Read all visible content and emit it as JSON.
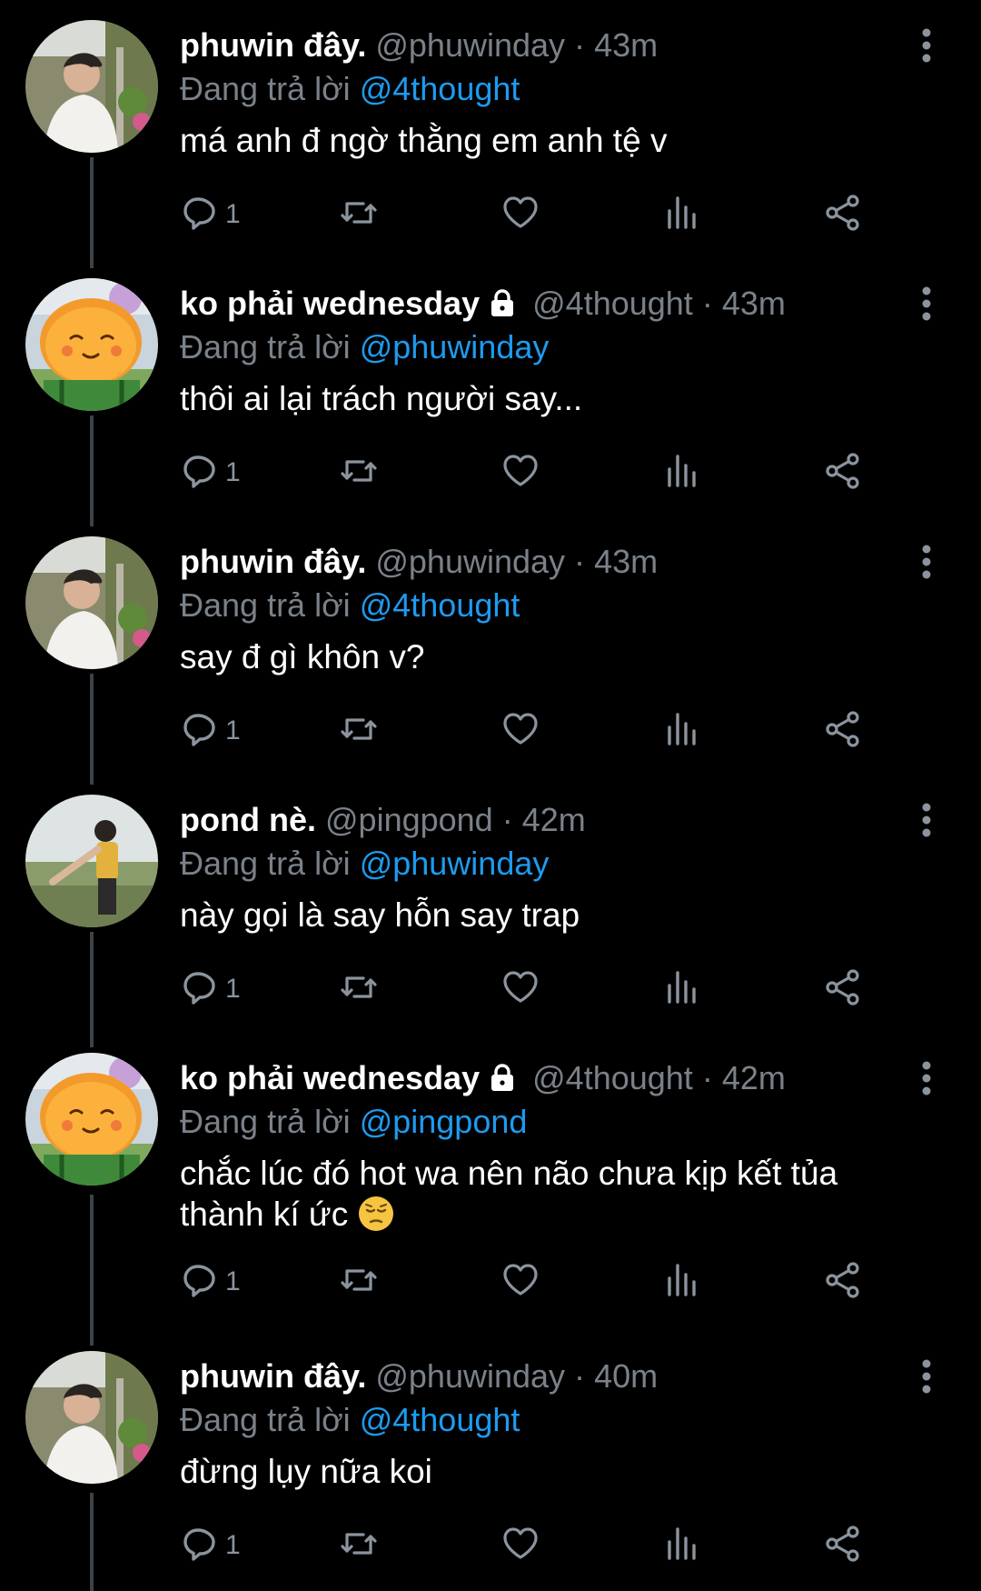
{
  "colors": {
    "background": "#000000",
    "muted": "#7a8189",
    "link": "#1d9bf0",
    "thread_line": "#3d4247"
  },
  "tweets": [
    {
      "name": "phuwin đây.",
      "locked": false,
      "handle": "@phuwinday",
      "sep": "·",
      "time": "43m",
      "reply_prefix": "Đang trả lời",
      "reply_to": "@4thought",
      "text": "má anh đ ngờ thằng em anh tệ v",
      "reply_count": "1",
      "avatar": "phuwin"
    },
    {
      "name": "ko phải wednesday",
      "locked": true,
      "handle": "@4thought",
      "sep": "·",
      "time": "43m",
      "reply_prefix": "Đang trả lời",
      "reply_to": "@phuwinday",
      "text": "thôi ai lại trách người say...",
      "reply_count": "1",
      "avatar": "cartoon"
    },
    {
      "name": "phuwin đây.",
      "locked": false,
      "handle": "@phuwinday",
      "sep": "·",
      "time": "43m",
      "reply_prefix": "Đang trả lời",
      "reply_to": "@4thought",
      "text": "say đ gì khôn v?",
      "reply_count": "1",
      "avatar": "phuwin"
    },
    {
      "name": "pond nè.",
      "locked": false,
      "handle": "@pingpond",
      "sep": "·",
      "time": "42m",
      "reply_prefix": "Đang trả lời",
      "reply_to": "@phuwinday",
      "text": "này gọi là say hỗn say trap",
      "reply_count": "1",
      "avatar": "pond"
    },
    {
      "name": "ko phải wednesday",
      "locked": true,
      "handle": "@4thought",
      "sep": "·",
      "time": "42m",
      "reply_prefix": "Đang trả lời",
      "reply_to": "@pingpond",
      "text": "chắc lúc đó hot wa nên não chưa kịp kết tủa thành kí ức",
      "emoji": "pensive-face-emoji",
      "reply_count": "1",
      "avatar": "cartoon"
    },
    {
      "name": "phuwin đây.",
      "locked": false,
      "handle": "@phuwinday",
      "sep": "·",
      "time": "40m",
      "reply_prefix": "Đang trả lời",
      "reply_to": "@4thought",
      "text": "đừng lụy nữa koi",
      "reply_count": "1",
      "avatar": "phuwin"
    }
  ],
  "icons": [
    "reply-icon",
    "retweet-icon",
    "like-icon",
    "views-icon",
    "share-icon",
    "more-options-icon",
    "lock-icon"
  ]
}
